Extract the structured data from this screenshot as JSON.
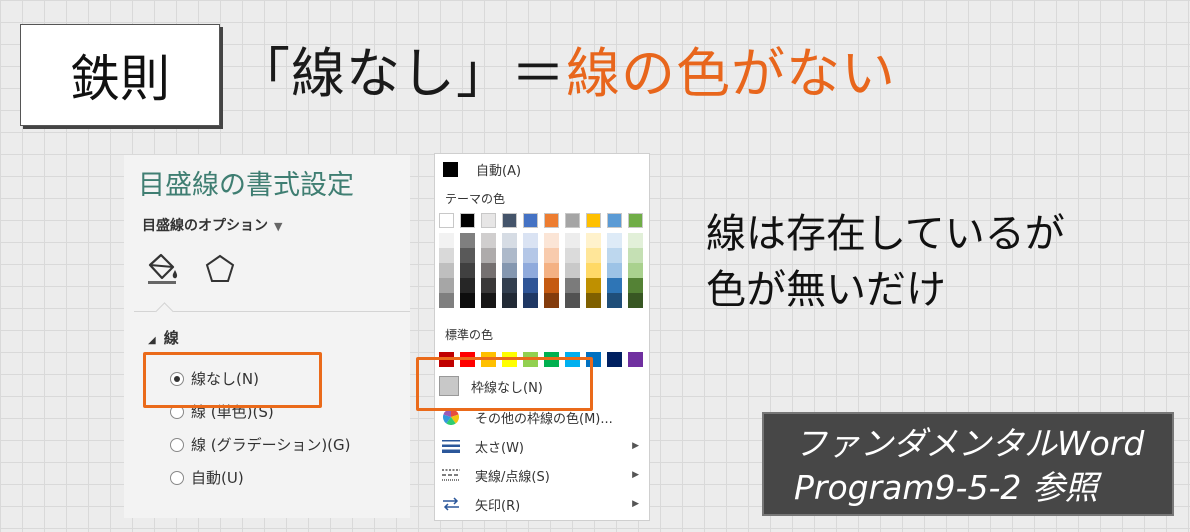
{
  "rule_box": {
    "label": "鉄則"
  },
  "headline": {
    "part1": "「線なし」＝",
    "part2": "線の色がない"
  },
  "colors": {
    "accent": "#e8661c",
    "pane_title": "#3f7e72",
    "highlight": "#ea6a1a"
  },
  "format_pane": {
    "title": "目盛線の書式設定",
    "options_label": "目盛線のオプション",
    "fill_icon": "paint-bucket-icon",
    "effects_icon": "pentagon-icon",
    "section": "線",
    "radio_options": [
      {
        "label": "線なし(N)",
        "selected": true
      },
      {
        "label": "線 (単色)(S)",
        "selected": false
      },
      {
        "label": "線 (グラデーション)(G)",
        "selected": false
      },
      {
        "label": "自動(U)",
        "selected": false
      }
    ]
  },
  "color_menu": {
    "auto_label": "自動(A)",
    "theme_label": "テーマの色",
    "theme_colors": [
      {
        "top": "#ffffff",
        "shades": [
          "#f2f2f2",
          "#d9d9d9",
          "#bfbfbf",
          "#a6a6a6",
          "#7f7f7f"
        ]
      },
      {
        "top": "#000000",
        "shades": [
          "#7f7f7f",
          "#595959",
          "#404040",
          "#262626",
          "#0d0d0d"
        ]
      },
      {
        "top": "#e7e6e6",
        "shades": [
          "#d0cece",
          "#aeabab",
          "#757070",
          "#3a3838",
          "#171616"
        ]
      },
      {
        "top": "#44546a",
        "shades": [
          "#d6dce4",
          "#adb9ca",
          "#8497b0",
          "#333f4f",
          "#222a35"
        ]
      },
      {
        "top": "#4472c4",
        "shades": [
          "#dae3f3",
          "#b4c7e7",
          "#8faadc",
          "#2f5597",
          "#1f3864"
        ]
      },
      {
        "top": "#ed7d31",
        "shades": [
          "#fbe5d6",
          "#f8cbad",
          "#f4b183",
          "#c55a11",
          "#843c0c"
        ]
      },
      {
        "top": "#a5a5a5",
        "shades": [
          "#ededed",
          "#dbdbdb",
          "#c9c9c9",
          "#7b7b7b",
          "#525252"
        ]
      },
      {
        "top": "#ffc000",
        "shades": [
          "#fff2cc",
          "#ffe699",
          "#ffd966",
          "#bf9000",
          "#7f6000"
        ]
      },
      {
        "top": "#5b9bd5",
        "shades": [
          "#deebf7",
          "#bdd7ee",
          "#9dc3e6",
          "#2e75b6",
          "#1f4e79"
        ]
      },
      {
        "top": "#70ad47",
        "shades": [
          "#e2f0d9",
          "#c5e0b4",
          "#a9d18e",
          "#548235",
          "#385723"
        ]
      }
    ],
    "standard_label": "標準の色",
    "standard_colors": [
      "#c00000",
      "#ff0000",
      "#ffc000",
      "#ffff00",
      "#92d050",
      "#00b050",
      "#00b0f0",
      "#0070c0",
      "#002060",
      "#7030a0"
    ],
    "no_border_label": "枠線なし(N)",
    "more_colors_label": "その他の枠線の色(M)...",
    "weight_label": "太さ(W)",
    "dash_label": "実線/点線(S)",
    "arrow_label": "矢印(R)"
  },
  "note": {
    "line1": "線は存在しているが",
    "line2": "色が無いだけ"
  },
  "reference": {
    "line1": "ファンダメンタルWord",
    "line2": "Program9-5-2 参照"
  }
}
